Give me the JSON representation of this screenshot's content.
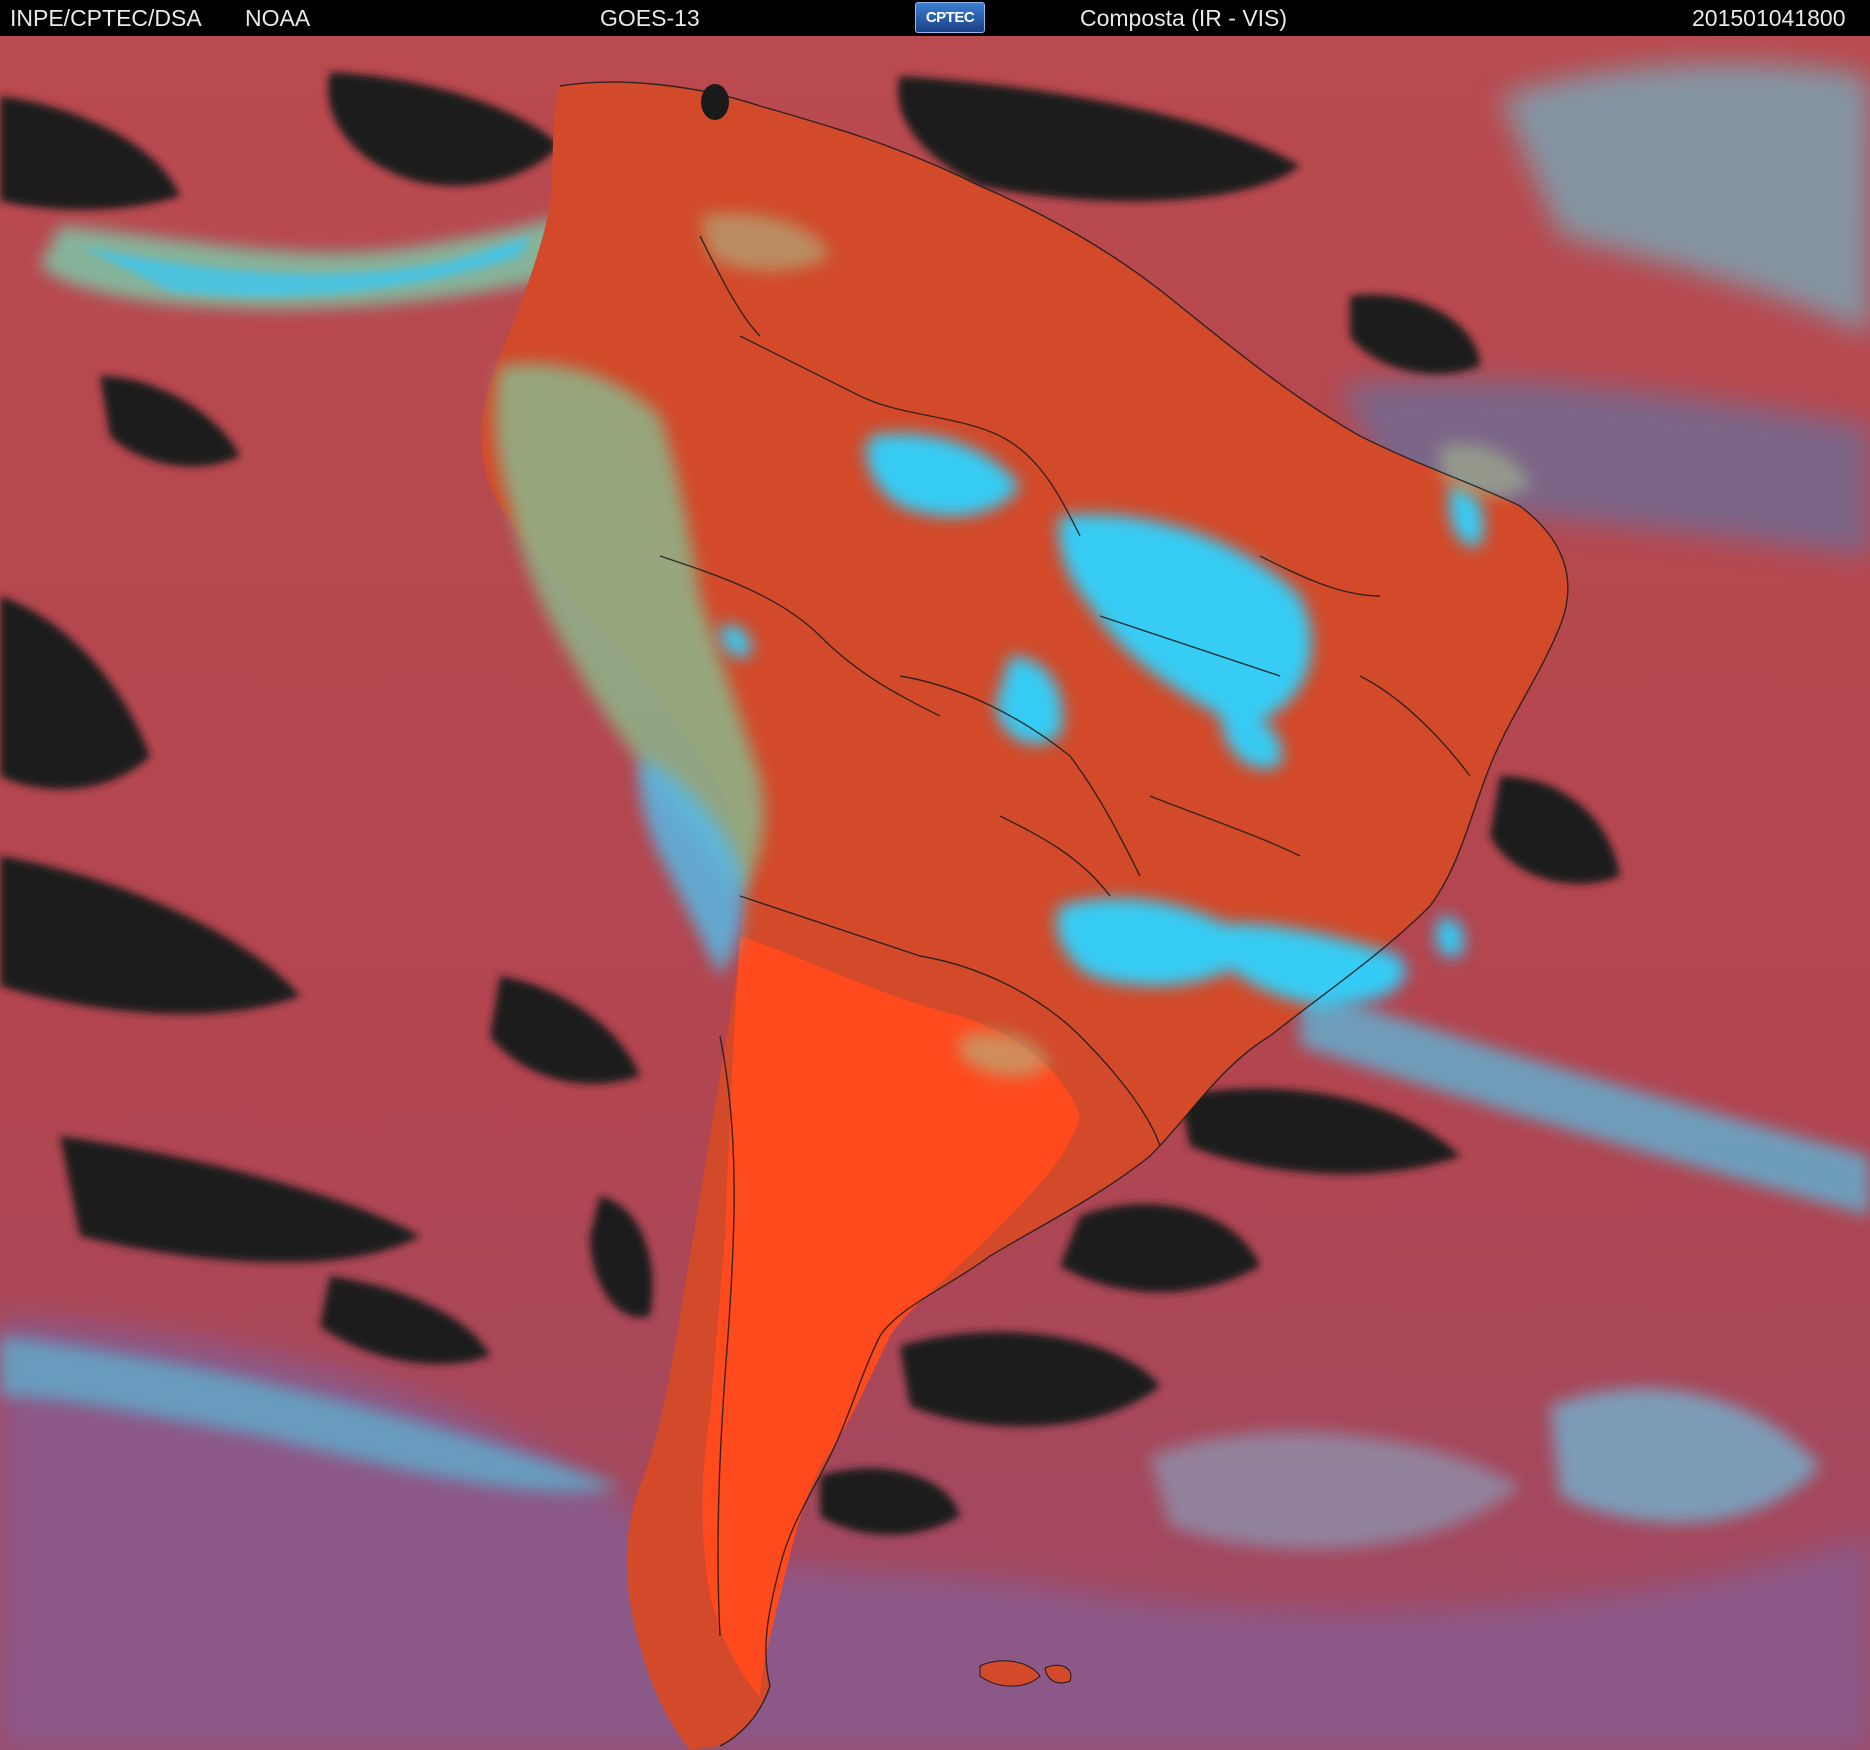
{
  "header": {
    "source": "INPE/CPTEC/DSA",
    "agency": "NOAA",
    "satellite": "GOES-13",
    "logo_text": "CPTEC",
    "product": "Composta (IR - VIS)",
    "timestamp": "201501041800"
  },
  "colors": {
    "header_bg": "#000000",
    "ocean_clear": "#b2454f",
    "land_clear": "#dd4a22",
    "high_cloud": "#2fd3ff",
    "low_cloud": "#7fb88a",
    "cold_cloud_top": "#1a1a1a",
    "borders": "#1b1b1b"
  }
}
